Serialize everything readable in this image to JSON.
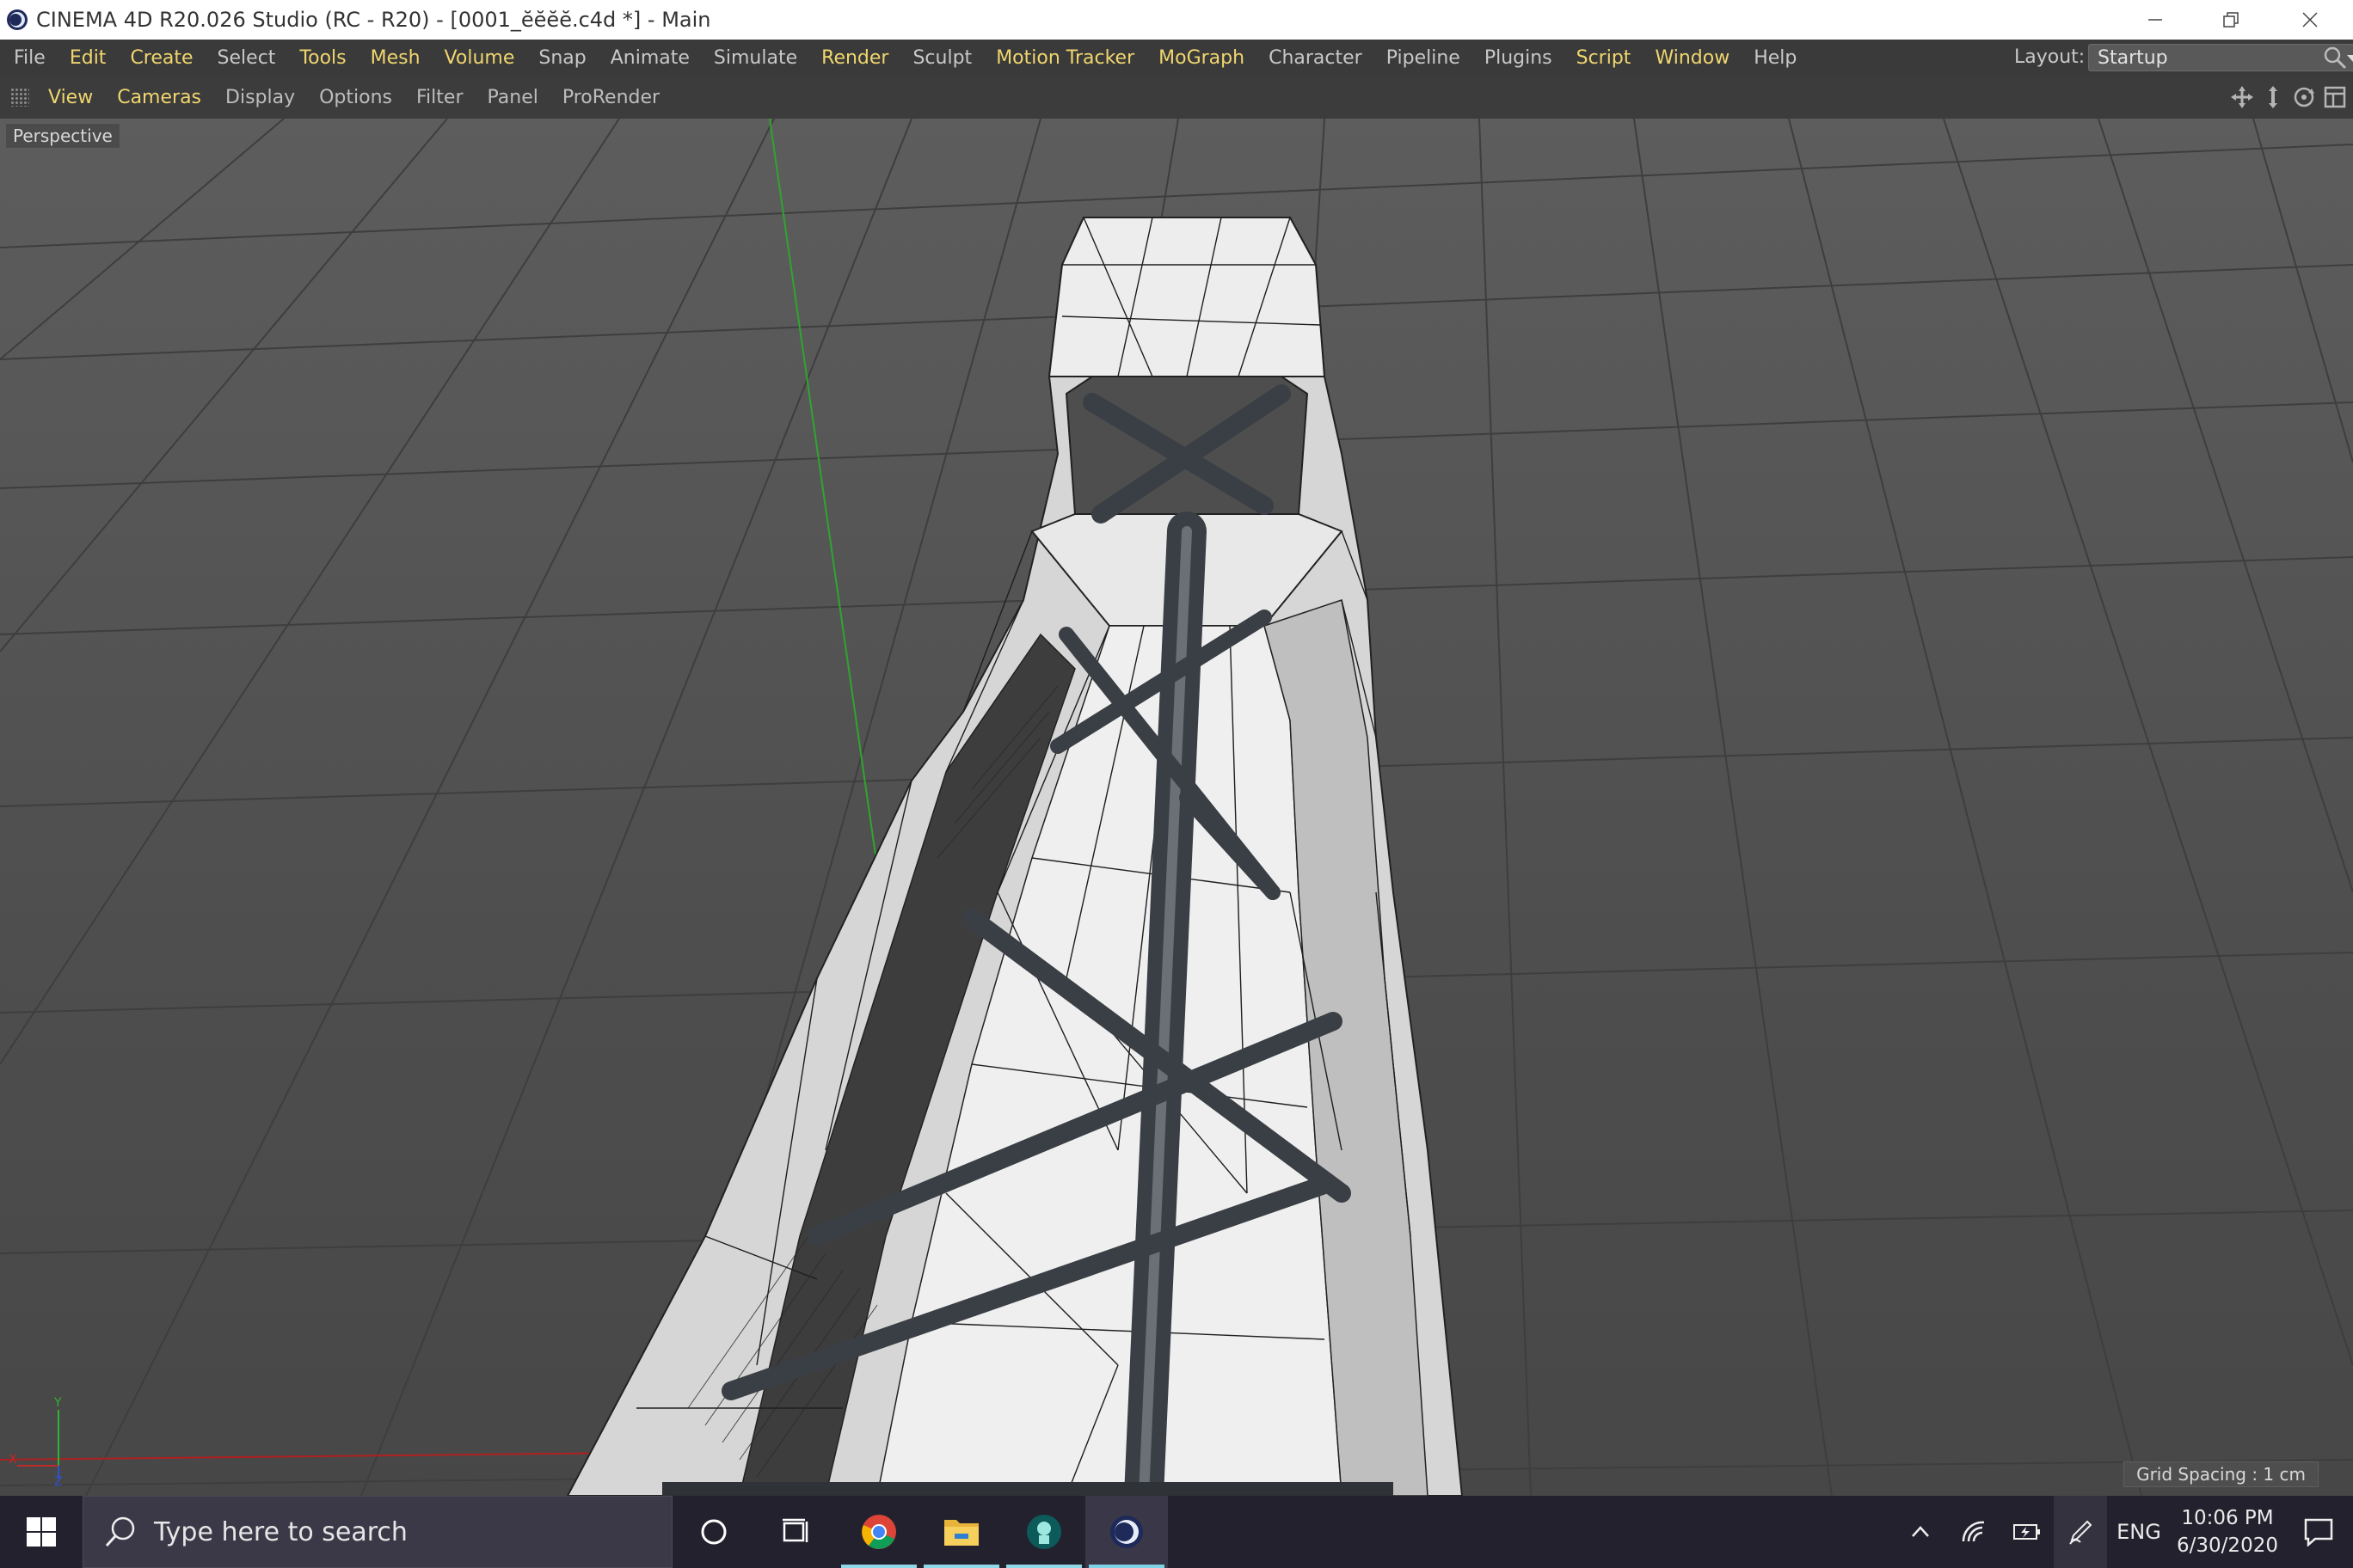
{
  "window": {
    "title": "CINEMA 4D R20.026 Studio (RC - R20) - [0001_ĕĕĕĕ.c4d *] - Main"
  },
  "menubar": {
    "items": [
      {
        "label": "File",
        "highlight": false
      },
      {
        "label": "Edit",
        "highlight": true
      },
      {
        "label": "Create",
        "highlight": true
      },
      {
        "label": "Select",
        "highlight": false
      },
      {
        "label": "Tools",
        "highlight": true
      },
      {
        "label": "Mesh",
        "highlight": true
      },
      {
        "label": "Volume",
        "highlight": true
      },
      {
        "label": "Snap",
        "highlight": false
      },
      {
        "label": "Animate",
        "highlight": false
      },
      {
        "label": "Simulate",
        "highlight": false
      },
      {
        "label": "Render",
        "highlight": true
      },
      {
        "label": "Sculpt",
        "highlight": false
      },
      {
        "label": "Motion Tracker",
        "highlight": true
      },
      {
        "label": "MoGraph",
        "highlight": true
      },
      {
        "label": "Character",
        "highlight": false
      },
      {
        "label": "Pipeline",
        "highlight": false
      },
      {
        "label": "Plugins",
        "highlight": false
      },
      {
        "label": "Script",
        "highlight": true
      },
      {
        "label": "Window",
        "highlight": true
      },
      {
        "label": "Help",
        "highlight": false
      }
    ],
    "layout_label": "Layout:",
    "layout_value": "Startup"
  },
  "viewport_menu": {
    "items": [
      {
        "label": "View",
        "highlight": true
      },
      {
        "label": "Cameras",
        "highlight": true
      },
      {
        "label": "Display",
        "highlight": false
      },
      {
        "label": "Options",
        "highlight": false
      },
      {
        "label": "Filter",
        "highlight": false
      },
      {
        "label": "Panel",
        "highlight": false
      },
      {
        "label": "ProRender",
        "highlight": false
      }
    ],
    "nav_icons": [
      "move-view-icon",
      "dolly-view-icon",
      "rotate-view-icon",
      "toggle-panel-icon"
    ]
  },
  "viewport": {
    "camera_label": "Perspective",
    "grid_spacing": "Grid Spacing : 1 cm",
    "axis_labels": {
      "y": "Y",
      "x": "X",
      "z": "Z"
    }
  },
  "taskbar": {
    "search_placeholder": "Type here to search",
    "apps": [
      "cortana-icon",
      "task-view-icon",
      "chrome-icon",
      "file-explorer-icon",
      "app-icon",
      "cinema4d-icon"
    ],
    "language": "ENG",
    "time": "10:06 PM",
    "date": "6/30/2020"
  },
  "colors": {
    "menu_highlight": "#f0d66e",
    "menu_text": "#c8c8c8",
    "viewport_bg": "#555555",
    "taskbar_bg": "#23212d"
  }
}
